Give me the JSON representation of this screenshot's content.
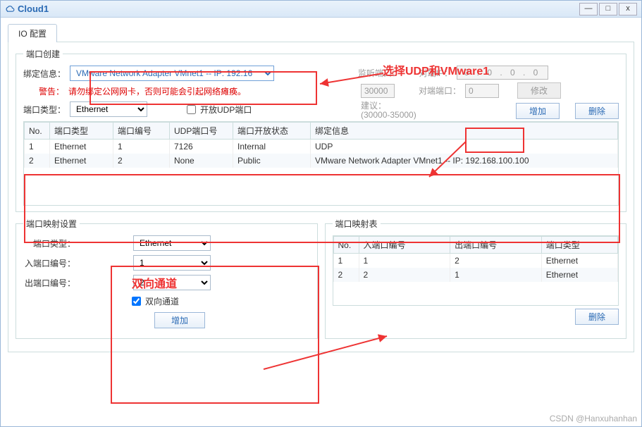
{
  "window": {
    "title": "Cloud1"
  },
  "tab": {
    "label": "IO 配置"
  },
  "port_create": {
    "legend": "端口创建",
    "bind_label": "绑定信息：",
    "bind_value": "VMware Network Adapter VMnet1 -- IP: 192.16",
    "warn_label": "警告：",
    "warn_text": "请勿绑定公网网卡，否则可能会引起网络瘫痪。",
    "type_label": "端口类型：",
    "type_value": "Ethernet",
    "open_udp_label": "开放UDP端口",
    "listen_label": "监听端口：",
    "listen_value": "30000",
    "suggest_label1": "建议：",
    "suggest_label2": "(30000-35000)",
    "peer_ip_label": "对端IP：",
    "peer_ip_value": "0 . 0 . 0 . 0",
    "peer_port_label": "对端端口：",
    "peer_port_value": "0",
    "modify_btn": "修改",
    "add_btn": "增加",
    "delete_btn": "删除"
  },
  "port_table": {
    "cols": {
      "no": "No.",
      "type": "端口类型",
      "num": "端口编号",
      "udp": "UDP端口号",
      "open": "端口开放状态",
      "bind": "绑定信息"
    },
    "rows": [
      {
        "no": "1",
        "type": "Ethernet",
        "num": "1",
        "udp": "7126",
        "open": "Internal",
        "bind": "UDP"
      },
      {
        "no": "2",
        "type": "Ethernet",
        "num": "2",
        "udp": "None",
        "open": "Public",
        "bind": "VMware Network Adapter VMnet1 -- IP: 192.168.100.100"
      }
    ]
  },
  "map_set": {
    "legend": "端口映射设置",
    "type_label": "端口类型：",
    "type_value": "Ethernet",
    "in_label": "入端口编号：",
    "in_value": "1",
    "out_label": "出端口编号：",
    "out_value": "2",
    "bidir_label": "双向通道",
    "add_btn": "增加"
  },
  "map_table": {
    "legend": "端口映射表",
    "cols": {
      "no": "No.",
      "in": "入端口编号",
      "out": "出端口编号",
      "type": "端口类型"
    },
    "rows": [
      {
        "no": "1",
        "in": "1",
        "out": "2",
        "type": "Ethernet"
      },
      {
        "no": "2",
        "in": "2",
        "out": "1",
        "type": "Ethernet"
      }
    ],
    "delete_btn": "删除"
  },
  "annotations": {
    "select_udp": "选择UDP和VMware1",
    "bidir": "双向通道"
  },
  "watermark": "CSDN @Hanxuhanhan"
}
